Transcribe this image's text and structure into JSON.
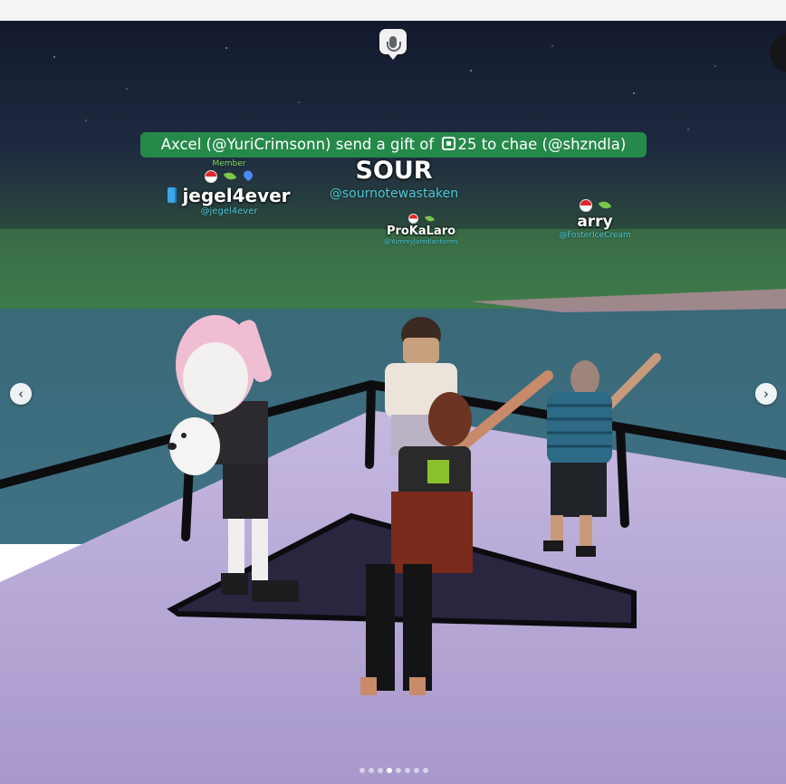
{
  "gift_banner": {
    "prefix": "Axcel (@YuriCrimsonn) send a gift of ",
    "amount": "25",
    "suffix": " to chae (@shzndla)",
    "currency_icon": "robux-icon",
    "color": "#25894a"
  },
  "players": [
    {
      "name": "jegel4ever",
      "handle": "@jegel4ever",
      "member_label": "Member",
      "badges": [
        "flag-icon",
        "leaf-icon",
        "heart-icon"
      ],
      "leading_icon": "book-icon"
    },
    {
      "name": "SOUR",
      "handle": "@sournotewastaken"
    },
    {
      "name": "ProKaLaro",
      "handle": "@YummyJaredlantorres",
      "badges": [
        "flag-icon",
        "leaf-icon"
      ]
    },
    {
      "name": "arry",
      "handle": "@FosterIceCream",
      "badges": [
        "flag-icon",
        "leaf-icon"
      ]
    }
  ],
  "controls": {
    "mic_icon": "microphone-icon",
    "prev_icon": "chevron-left-icon",
    "prev_glyph": "‹",
    "next_icon": "chevron-right-icon",
    "next_glyph": "›"
  },
  "carousel": {
    "total": 8,
    "active_index": 3
  },
  "colors": {
    "sky": "#1a2338",
    "water": "#3c6e80",
    "deck": "#b7a8d6",
    "handle": "#4fc9d8"
  }
}
